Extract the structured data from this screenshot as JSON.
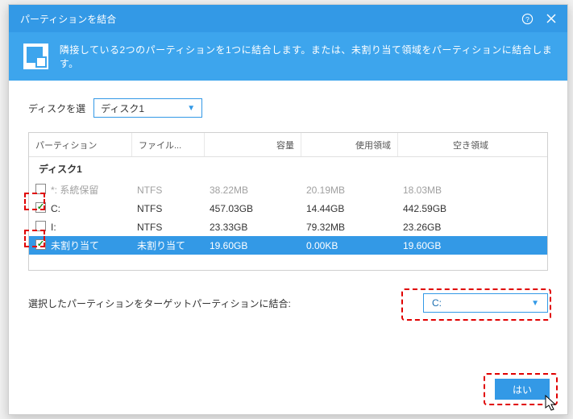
{
  "window": {
    "title": "パーティションを結合"
  },
  "header": {
    "desc": "隣接している2つのパーティションを1つに結合します。または、未割り当て領域をパーティションに結合します。"
  },
  "diskSelector": {
    "label": "ディスクを選",
    "value": "ディスク1"
  },
  "columns": {
    "name": "パーティション",
    "fs": "ファイル...",
    "cap": "容量",
    "used": "使用領域",
    "free": "空き領域"
  },
  "group": "ディスク1",
  "rows": [
    {
      "checked": false,
      "name": "*: 系統保留",
      "fs": "NTFS",
      "cap": "38.22MB",
      "used": "20.19MB",
      "free": "18.03MB",
      "disabled": true,
      "selected": false
    },
    {
      "checked": true,
      "name": "C:",
      "fs": "NTFS",
      "cap": "457.03GB",
      "used": "14.44GB",
      "free": "442.59GB",
      "disabled": false,
      "selected": false
    },
    {
      "checked": false,
      "name": "I:",
      "fs": "NTFS",
      "cap": "23.33GB",
      "used": "79.32MB",
      "free": "23.26GB",
      "disabled": false,
      "selected": false
    },
    {
      "checked": true,
      "name": "未割り当て",
      "fs": "未割り当て",
      "cap": "19.60GB",
      "used": "0.00KB",
      "free": "19.60GB",
      "disabled": false,
      "selected": true
    }
  ],
  "target": {
    "label": "選択したパーティションをターゲットパーティションに結合:",
    "value": "C:"
  },
  "buttons": {
    "ok": "はい"
  }
}
